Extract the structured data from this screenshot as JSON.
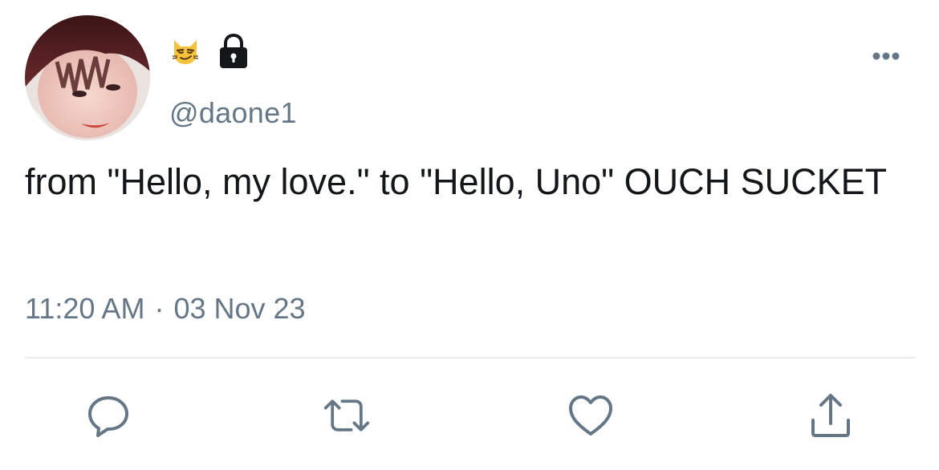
{
  "user": {
    "handle": "@daone1",
    "badge_emoji": "smirking-cat-emoji",
    "protected_icon": "lock-icon"
  },
  "tweet": {
    "text": "from \"Hello, my love.\" to \"Hello, Uno\" OUCH SUCKET",
    "time": "11:20 AM",
    "separator": "·",
    "date": "03 Nov 23"
  },
  "actions": [
    {
      "name": "reply",
      "icon": "speech-bubble-icon"
    },
    {
      "name": "retweet",
      "icon": "retweet-arrows-icon"
    },
    {
      "name": "like",
      "icon": "heart-icon"
    },
    {
      "name": "share",
      "icon": "share-upload-icon"
    }
  ],
  "colors": {
    "text": "#14171a",
    "secondary": "#657786",
    "divider": "#e6ecf0",
    "emoji_yellow": "#f5c33b"
  }
}
